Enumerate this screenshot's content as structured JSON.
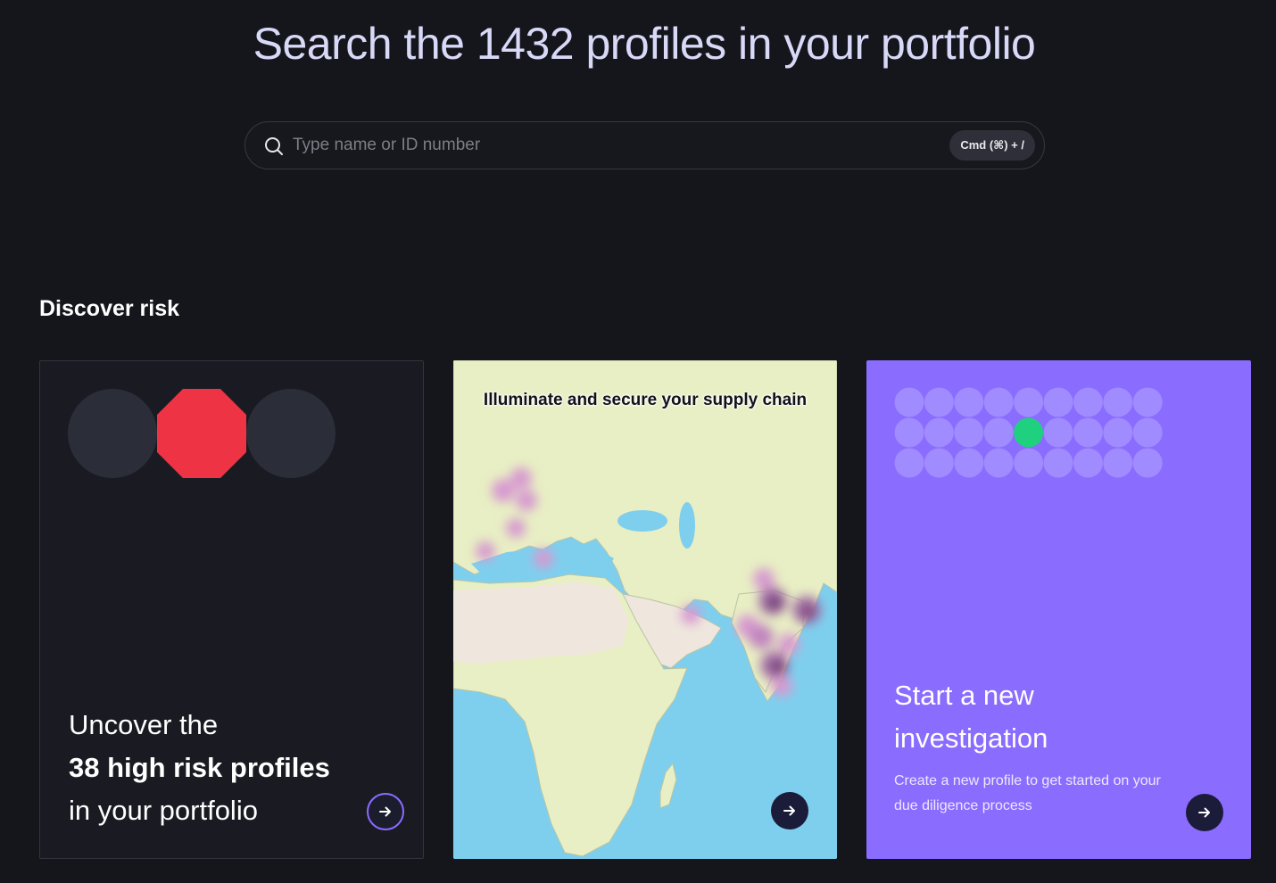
{
  "headline": "Search the 1432 profiles in your portfolio",
  "search": {
    "placeholder": "Type name or ID number",
    "shortcut": "Cmd (⌘) + /"
  },
  "section_title": "Discover risk",
  "cards": {
    "risk": {
      "line1": "Uncover the",
      "line2": "38 high risk profiles",
      "line3": "in your portfolio"
    },
    "map": {
      "title": "Illuminate and secure your supply chain"
    },
    "investigation": {
      "title_line1": "Start a new",
      "title_line2": "investigation",
      "description": "Create a new profile to get started on your due diligence process"
    }
  },
  "colors": {
    "background": "#15161c",
    "accent": "#8a6cff",
    "risk_red": "#ee3344",
    "map_sea": "#7ecfee",
    "highlight_green": "#1fd17f"
  },
  "icons": [
    "search-icon",
    "arrow-right-icon"
  ]
}
